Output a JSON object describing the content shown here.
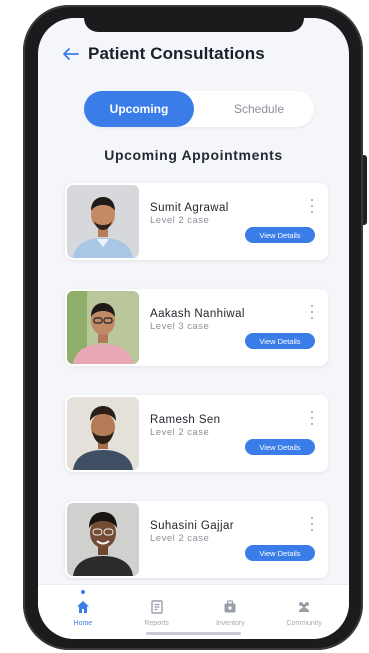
{
  "header": {
    "title": "Patient Consultations"
  },
  "segment": {
    "active_label": "Upcoming",
    "inactive_label": "Schedule"
  },
  "section": {
    "title": "Upcoming Appointments"
  },
  "appointments": [
    {
      "name": "Sumit Agrawal",
      "level": "Level 2 case",
      "button": "View Details"
    },
    {
      "name": "Aakash Nanhiwal",
      "level": "Level 3 case",
      "button": "View Details"
    },
    {
      "name": "Ramesh Sen",
      "level": "Level 2 case",
      "button": "View Details"
    },
    {
      "name": "Suhasini Gajjar",
      "level": "Level 2 case",
      "button": "View Details"
    }
  ],
  "tabs": [
    {
      "label": "Home",
      "icon": "home-icon",
      "active": true
    },
    {
      "label": "Reports",
      "icon": "reports-icon",
      "active": false
    },
    {
      "label": "Inventory",
      "icon": "inventory-icon",
      "active": false
    },
    {
      "label": "Community",
      "icon": "community-icon",
      "active": false
    }
  ],
  "colors": {
    "accent": "#3a7de8",
    "background": "#f4f6fa",
    "text": "#1c1f2a"
  }
}
